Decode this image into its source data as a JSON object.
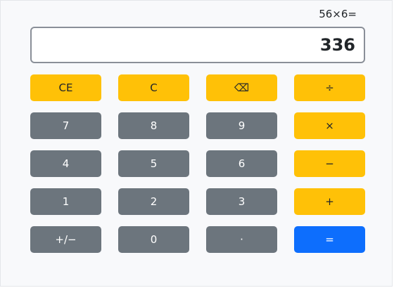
{
  "calculator": {
    "expression": "56×6=",
    "display_value": "336",
    "keys": [
      {
        "label": "CE",
        "style": "yellow"
      },
      {
        "label": "C",
        "style": "yellow"
      },
      {
        "label": "⌫",
        "style": "yellow"
      },
      {
        "label": "÷",
        "style": "yellow"
      },
      {
        "label": "7",
        "style": "gray"
      },
      {
        "label": "8",
        "style": "gray"
      },
      {
        "label": "9",
        "style": "gray"
      },
      {
        "label": "×",
        "style": "yellow"
      },
      {
        "label": "4",
        "style": "gray"
      },
      {
        "label": "5",
        "style": "gray"
      },
      {
        "label": "6",
        "style": "gray"
      },
      {
        "label": "−",
        "style": "yellow"
      },
      {
        "label": "1",
        "style": "gray"
      },
      {
        "label": "2",
        "style": "gray"
      },
      {
        "label": "3",
        "style": "gray"
      },
      {
        "label": "+",
        "style": "yellow"
      },
      {
        "label": "+/−",
        "style": "gray"
      },
      {
        "label": "0",
        "style": "gray"
      },
      {
        "label": "·",
        "style": "gray"
      },
      {
        "label": "=",
        "style": "blue"
      }
    ]
  },
  "colors": {
    "operator_key": "#ffc107",
    "digit_key": "#6c757d",
    "equals_key": "#0d6efd",
    "display_border": "#8a8f98",
    "background": "#f8f9fb"
  }
}
